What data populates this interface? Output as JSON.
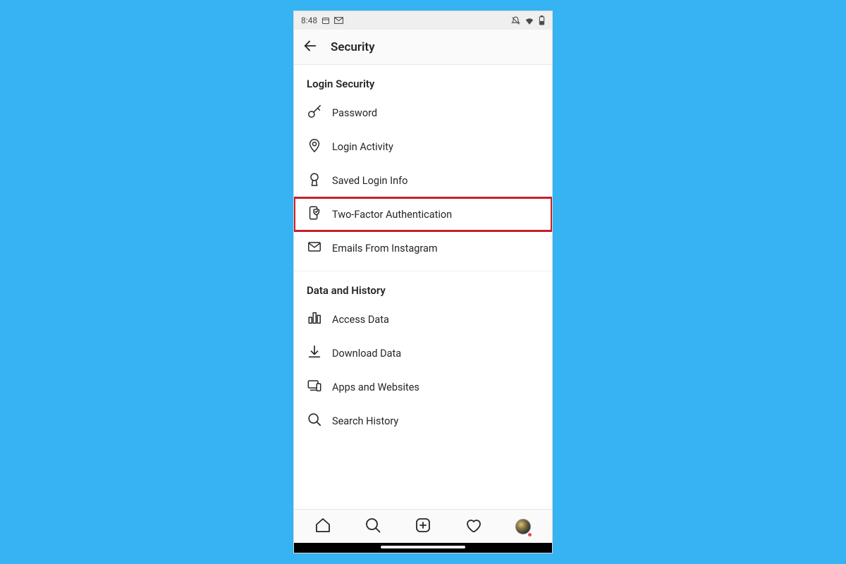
{
  "statusbar": {
    "time": "8:48"
  },
  "appbar": {
    "title": "Security"
  },
  "sections": {
    "login": {
      "title": "Login Security",
      "items": {
        "password": "Password",
        "login_activity": "Login Activity",
        "saved_login_info": "Saved Login Info",
        "two_factor": "Two-Factor Authentication",
        "emails": "Emails From Instagram"
      }
    },
    "data": {
      "title": "Data and History",
      "items": {
        "access_data": "Access Data",
        "download_data": "Download Data",
        "apps_websites": "Apps and Websites",
        "search_history": "Search History"
      }
    }
  },
  "highlight": {
    "target": "two_factor",
    "color": "#c52027"
  }
}
